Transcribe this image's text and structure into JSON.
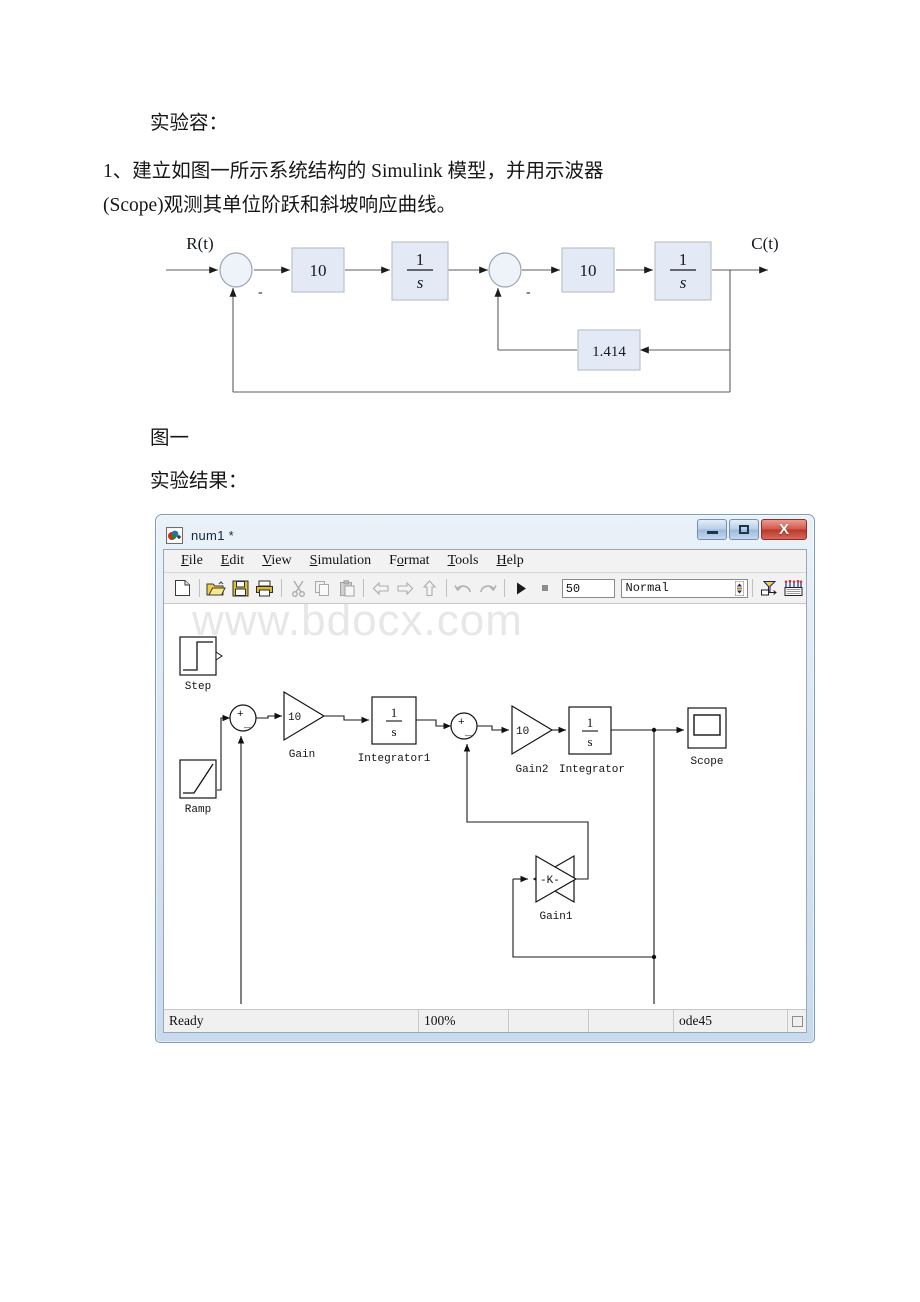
{
  "document": {
    "heading": "实验容：",
    "task_line1": "1、建立如图一所示系统结构的 Simulink 模型，并用示波器",
    "task_line2": "(Scope)观测其单位阶跃和斜坡响应曲线。",
    "figure_caption": "图一",
    "result_label": "实验结果："
  },
  "block_diagram": {
    "input_label": "R(t)",
    "output_label": "C(t)",
    "gain1": "10",
    "integrator1_num": "1",
    "integrator1_den": "s",
    "gain2": "10",
    "integrator2_num": "1",
    "integrator2_den": "s",
    "feedback_gain": "1.414",
    "sum1_sign": "-",
    "sum2_sign": "-",
    "block_fill": "#e3eaf5",
    "block_stroke": "#b9bcc4"
  },
  "simulink": {
    "title": "num1 *",
    "window_buttons": {
      "minimize": "minimize",
      "maximize": "maximize",
      "close": "X"
    },
    "menus": [
      {
        "name": "file",
        "accel": "F",
        "rest": "ile"
      },
      {
        "name": "edit",
        "accel": "E",
        "rest": "dit"
      },
      {
        "name": "view",
        "accel": "V",
        "rest": "iew"
      },
      {
        "name": "simulation",
        "accel": "S",
        "rest": "imulation"
      },
      {
        "name": "format",
        "pre": "F",
        "accel": "o",
        "rest": "rmat"
      },
      {
        "name": "tools",
        "accel": "T",
        "rest": "ools"
      },
      {
        "name": "help",
        "accel": "H",
        "rest": "elp"
      }
    ],
    "toolbar": {
      "icons": [
        "new-model-icon",
        "open-model-icon",
        "save-icon",
        "print-icon",
        "cut-icon",
        "copy-icon",
        "paste-icon",
        "back-icon",
        "forward-icon",
        "up-icon",
        "undo-icon",
        "redo-icon",
        "start-simulation-icon",
        "stop-simulation-icon"
      ],
      "sim_stop_time": "50",
      "sim_mode": "Normal",
      "right_icons": [
        "update-diagram-icon",
        "model-explorer-icon"
      ]
    },
    "watermark": "www.bdocx.com",
    "blocks": [
      {
        "id": "step",
        "label": "Step",
        "type": "source-step"
      },
      {
        "id": "ramp",
        "label": "Ramp",
        "type": "source-ramp"
      },
      {
        "id": "sum1",
        "label": "",
        "type": "sum",
        "signs": [
          "+",
          "-"
        ]
      },
      {
        "id": "gain",
        "label": "Gain",
        "type": "gain",
        "value": "10"
      },
      {
        "id": "integrator1",
        "label": "Integrator1",
        "type": "integrator",
        "num": "1",
        "den": "s"
      },
      {
        "id": "sum2",
        "label": "",
        "type": "sum",
        "signs": [
          "+",
          "-"
        ]
      },
      {
        "id": "gain2",
        "label": "Gain2",
        "type": "gain",
        "value": "10"
      },
      {
        "id": "integrator",
        "label": "Integrator",
        "type": "integrator",
        "num": "1",
        "den": "s"
      },
      {
        "id": "gain1",
        "label": "Gain1",
        "type": "gain-left",
        "value": "-K-"
      },
      {
        "id": "scope",
        "label": "Scope",
        "type": "sink-scope"
      }
    ],
    "statusbar": {
      "status": "Ready",
      "zoom": "100%",
      "empty1": "",
      "empty2": "",
      "solver": "ode45"
    }
  }
}
